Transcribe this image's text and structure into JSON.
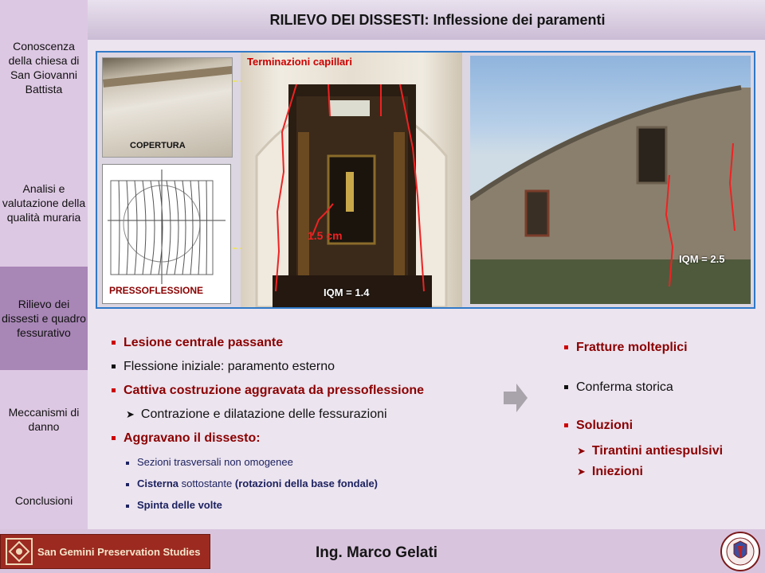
{
  "sidebar": {
    "items": [
      {
        "label": "Conoscenza della chiesa di San Giovanni Battista",
        "active": false
      },
      {
        "label": "Analisi e valutazione della qualità muraria",
        "active": false
      },
      {
        "label": "Rilievo dei dissesti e quadro fessurativo",
        "active": true
      },
      {
        "label": "Meccanismi di danno",
        "active": false
      },
      {
        "label": "Conclusioni",
        "active": false
      }
    ]
  },
  "title": "RILIEVO DEI DISSESTI: Inflessione dei paramenti",
  "photos": {
    "roof_caption": "COPERTURA",
    "diagram_caption": "PRESSOFLESSIONE",
    "altar_top_label": "Terminazioni capillari",
    "altar_crack_label": "1.5 cm",
    "altar_iqm": "IQM = 1.4",
    "facade_iqm": "IQM = 2.5"
  },
  "bullets_left": [
    {
      "text": "Lesione centrale passante",
      "style": "red",
      "marker": "square"
    },
    {
      "text": "Flessione iniziale: paramento esterno",
      "style": "black",
      "marker": "square"
    },
    {
      "text": "Cattiva costruzione aggravata da pressoflessione",
      "style": "red",
      "marker": "square"
    },
    {
      "text": "Contrazione e dilatazione delle fessurazioni",
      "style": "black",
      "marker": "arrow"
    },
    {
      "text": "Aggravano il dissesto:",
      "style": "red",
      "marker": "square"
    },
    {
      "text": "Sezioni trasversali non omogenee",
      "style": "navy",
      "marker": "small-square"
    },
    {
      "text": "Cisterna",
      "rest": " sottostante ",
      "extra": "(rotazioni della base fondale)",
      "style": "navy",
      "marker": "small-square"
    },
    {
      "text": "Spinta delle volte",
      "style": "navy",
      "marker": "small-square"
    }
  ],
  "bullets_right": [
    {
      "text": "Fratture molteplici",
      "style": "red",
      "marker": "square"
    },
    {
      "text": "Conferma storica",
      "style": "black",
      "marker": "square"
    },
    {
      "text": "Soluzioni",
      "style": "red",
      "marker": "square"
    },
    {
      "text": "Tirantini antiespulsivi",
      "style": "red",
      "marker": "arrow"
    },
    {
      "text": "Iniezioni",
      "style": "red",
      "marker": "arrow"
    }
  ],
  "footer": {
    "logo_text": "San Gemini Preservation Studies",
    "author": "Ing. Marco Gelati"
  },
  "colors": {
    "accent_red": "#8b0000",
    "navy": "#1d2260",
    "sidebar_active": "#a886b6",
    "panel_border": "#2f79c8"
  }
}
